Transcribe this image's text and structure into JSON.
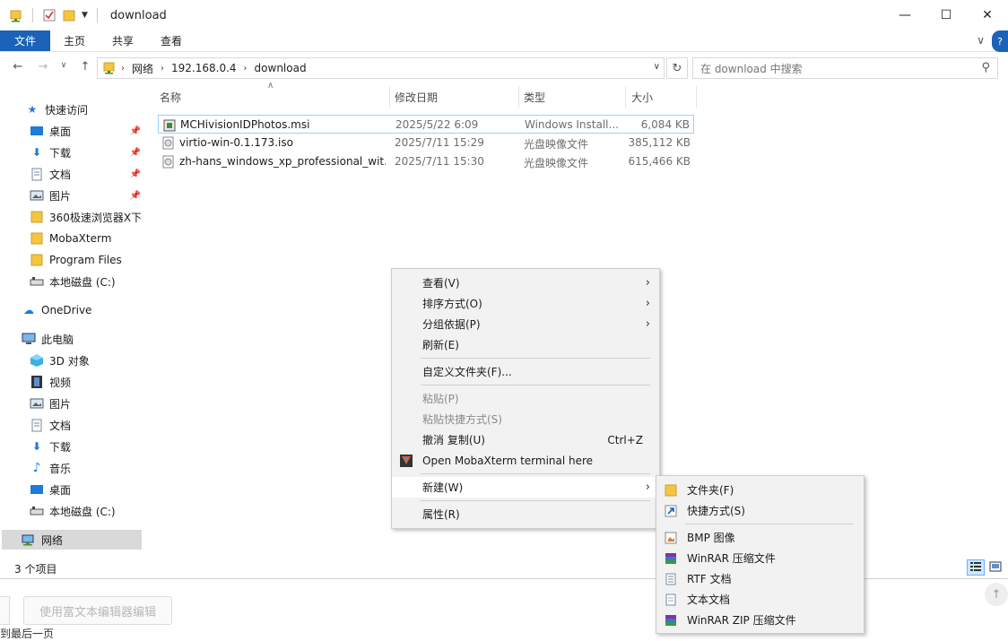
{
  "window": {
    "title": "download",
    "controls": {
      "minimize": "—",
      "maximize": "☐",
      "close": "✕"
    }
  },
  "ribbon": {
    "tabs": [
      "文件",
      "主页",
      "共享",
      "查看"
    ]
  },
  "address": {
    "crumbs": [
      "网络",
      "192.168.0.4",
      "download"
    ],
    "search_placeholder": "在 download 中搜索"
  },
  "sidebar": {
    "quick_access": "快速访问",
    "quick_items": [
      "桌面",
      "下载",
      "文档",
      "图片",
      "360极速浏览器X下载",
      "MobaXterm",
      "Program Files",
      "本地磁盘 (C:)"
    ],
    "onedrive": "OneDrive",
    "this_pc": "此电脑",
    "pc_items": [
      "3D 对象",
      "视频",
      "图片",
      "文档",
      "下载",
      "音乐",
      "桌面",
      "本地磁盘 (C:)"
    ],
    "network": "网络"
  },
  "columns": {
    "name": "名称",
    "date": "修改日期",
    "type": "类型",
    "size": "大小"
  },
  "files": [
    {
      "name": "MCHivisionIDPhotos.msi",
      "date": "2025/5/22 6:09",
      "type": "Windows Install...",
      "size": "6,084 KB",
      "icon": "msi-installer-icon"
    },
    {
      "name": "virtio-win-0.1.173.iso",
      "date": "2025/7/11 15:29",
      "type": "光盘映像文件",
      "size": "385,112 KB",
      "icon": "disc-image-icon"
    },
    {
      "name": "zh-hans_windows_xp_professional_wit...",
      "date": "2025/7/11 15:30",
      "type": "光盘映像文件",
      "size": "615,466 KB",
      "icon": "disc-image-icon"
    }
  ],
  "status": {
    "count": "3 个项目"
  },
  "context_menu": {
    "view": "查看(V)",
    "sort": "排序方式(O)",
    "group": "分组依据(P)",
    "refresh": "刷新(E)",
    "customize": "自定义文件夹(F)...",
    "paste": "粘贴(P)",
    "paste_shortcut": "粘贴快捷方式(S)",
    "undo": "撤消 复制(U)",
    "undo_shortcut": "Ctrl+Z",
    "mobaxterm": "Open MobaXterm terminal here",
    "new": "新建(W)",
    "properties": "属性(R)"
  },
  "new_submenu": {
    "folder": "文件夹(F)",
    "shortcut": "快捷方式(S)",
    "bmp": "BMP 图像",
    "winrar": "WinRAR 压缩文件",
    "rtf": "RTF 文档",
    "txt": "文本文档",
    "winrar_zip": "WinRAR ZIP 压缩文件"
  },
  "below": {
    "button": "使用富文本编辑器编辑",
    "text": "到最后一页"
  },
  "colors": {
    "accent": "#1a63b8",
    "folder": "#f5c542",
    "selection_border": "#99d1ff"
  }
}
